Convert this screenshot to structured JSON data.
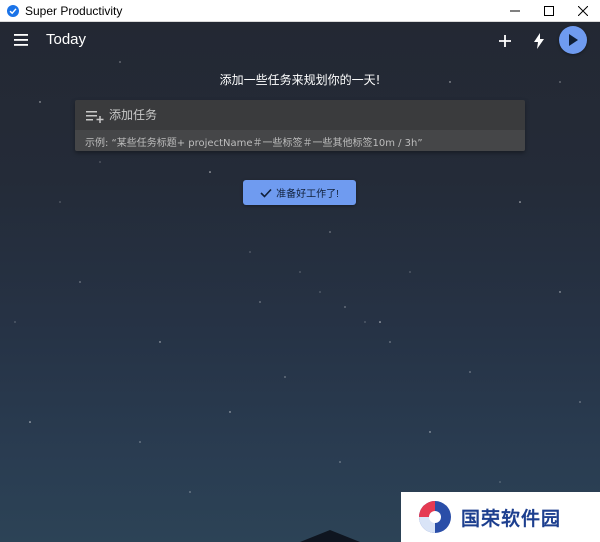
{
  "window": {
    "title": "Super Productivity",
    "controls": [
      "minimize-icon",
      "maximize-icon",
      "close-icon"
    ]
  },
  "toolbar": {
    "title": "Today",
    "icons": [
      "menu-icon",
      "add-icon",
      "lightning-icon",
      "play-icon"
    ]
  },
  "main": {
    "headline": "添加一些任务来规划你的一天!",
    "add_task": {
      "placeholder": "添加任务",
      "value": "",
      "hint": "示例: “某些任务标题+ projectName＃一些标签＃一些其他标签10m / 3h”"
    },
    "ready_button": {
      "label": "准备好工作了!",
      "icon": "check-icon"
    }
  },
  "watermark": {
    "text": "国荣软件园"
  },
  "colors": {
    "accent": "#6f9bf0",
    "background": "#232833",
    "card": "#3a3b3d"
  }
}
